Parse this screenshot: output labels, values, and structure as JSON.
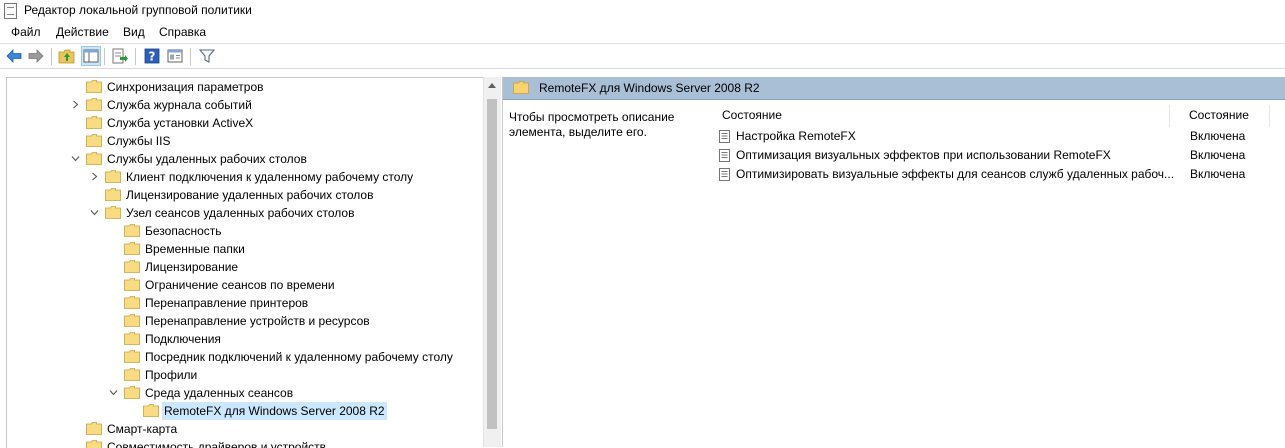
{
  "window": {
    "title": "Редактор локальной групповой политики"
  },
  "menu": [
    "Файл",
    "Действие",
    "Вид",
    "Справка"
  ],
  "toolbar": {
    "icons": [
      "back-arrow-icon",
      "forward-arrow-icon",
      "folder-up-icon",
      "show-hide-tree-icon",
      "export-list-icon",
      "help-icon",
      "properties-icon",
      "filter-icon"
    ]
  },
  "tree": {
    "items": [
      {
        "label": "Синхронизация параметров",
        "level": 0,
        "chevron": "none"
      },
      {
        "label": "Служба журнала событий",
        "level": 0,
        "chevron": "collapsed"
      },
      {
        "label": "Служба установки ActiveX",
        "level": 0,
        "chevron": "none"
      },
      {
        "label": "Службы IIS",
        "level": 0,
        "chevron": "none"
      },
      {
        "label": "Службы удаленных рабочих столов",
        "level": 0,
        "chevron": "expanded"
      },
      {
        "label": "Клиент подключения к удаленному рабочему столу",
        "level": 1,
        "chevron": "collapsed"
      },
      {
        "label": "Лицензирование удаленных рабочих столов",
        "level": 1,
        "chevron": "none"
      },
      {
        "label": "Узел сеансов удаленных рабочих столов",
        "level": 1,
        "chevron": "expanded"
      },
      {
        "label": "Безопасность",
        "level": 2,
        "chevron": "none"
      },
      {
        "label": "Временные папки",
        "level": 2,
        "chevron": "none"
      },
      {
        "label": "Лицензирование",
        "level": 2,
        "chevron": "none"
      },
      {
        "label": "Ограничение сеансов по времени",
        "level": 2,
        "chevron": "none"
      },
      {
        "label": "Перенаправление принтеров",
        "level": 2,
        "chevron": "none"
      },
      {
        "label": "Перенаправление устройств и ресурсов",
        "level": 2,
        "chevron": "none"
      },
      {
        "label": "Подключения",
        "level": 2,
        "chevron": "none"
      },
      {
        "label": "Посредник подключений к удаленному рабочему столу",
        "level": 2,
        "chevron": "none"
      },
      {
        "label": "Профили",
        "level": 2,
        "chevron": "none"
      },
      {
        "label": "Среда удаленных сеансов",
        "level": 2,
        "chevron": "expanded"
      },
      {
        "label": "RemoteFX для Windows Server 2008 R2",
        "level": 3,
        "chevron": "none",
        "selected": true
      },
      {
        "label": "Смарт-карта",
        "level": 0,
        "chevron": "none"
      },
      {
        "label": "Совместимость драйверов и устройств",
        "level": 0,
        "chevron": "none"
      }
    ]
  },
  "content": {
    "header": "RemoteFX для Windows Server 2008 R2",
    "description": "Чтобы просмотреть описание элемента, выделите его.",
    "columns": {
      "name": "Состояние",
      "state": "Состояние"
    },
    "rows": [
      {
        "name": "Настройка RemoteFX",
        "state": "Включена"
      },
      {
        "name": "Оптимизация визуальных эффектов при использовании RemoteFX",
        "state": "Включена"
      },
      {
        "name": "Оптимизировать визуальные эффекты для сеансов служб удаленных рабоч...",
        "state": "Включена"
      }
    ]
  },
  "colors": {
    "header_bg": "#a8bfd6",
    "selection": "#cce8ff",
    "folder": "#f5d36e"
  }
}
